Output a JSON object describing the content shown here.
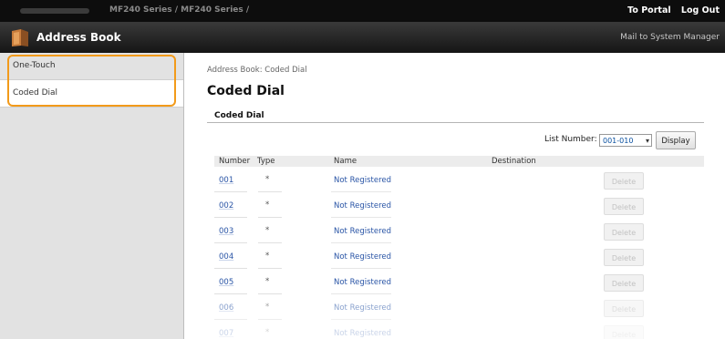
{
  "topbar": {
    "host": "",
    "breadcrumb": "MF240 Series / MF240 Series /",
    "to_portal": "To Portal",
    "log_out": "Log Out"
  },
  "appbar": {
    "title": "Address Book",
    "mail": "Mail to System Manager"
  },
  "sidebar": {
    "items": [
      {
        "label": "One-Touch",
        "active": false
      },
      {
        "label": "Coded Dial",
        "active": true
      }
    ]
  },
  "main": {
    "breadcrumb": "Address Book: Coded Dial",
    "title": "Coded Dial",
    "section_title": "Coded Dial",
    "list_number_label": "List Number:",
    "list_number_value": "001-010",
    "display_button": "Display",
    "columns": [
      "Number",
      "Type",
      "Name",
      "Destination"
    ],
    "rows": [
      {
        "number": "001",
        "type": "*",
        "name": "Not Registered",
        "destination": "",
        "delete": "Delete"
      },
      {
        "number": "002",
        "type": "*",
        "name": "Not Registered",
        "destination": "",
        "delete": "Delete"
      },
      {
        "number": "003",
        "type": "*",
        "name": "Not Registered",
        "destination": "",
        "delete": "Delete"
      },
      {
        "number": "004",
        "type": "*",
        "name": "Not Registered",
        "destination": "",
        "delete": "Delete"
      },
      {
        "number": "005",
        "type": "*",
        "name": "Not Registered",
        "destination": "",
        "delete": "Delete"
      },
      {
        "number": "006",
        "type": "*",
        "name": "Not Registered",
        "destination": "",
        "delete": "Delete"
      },
      {
        "number": "007",
        "type": "*",
        "name": "Not Registered",
        "destination": "",
        "delete": "Delete"
      }
    ]
  },
  "colors": {
    "highlight": "#f29a1a",
    "link": "#2a55a6",
    "topbar": "#0d0d0d"
  }
}
